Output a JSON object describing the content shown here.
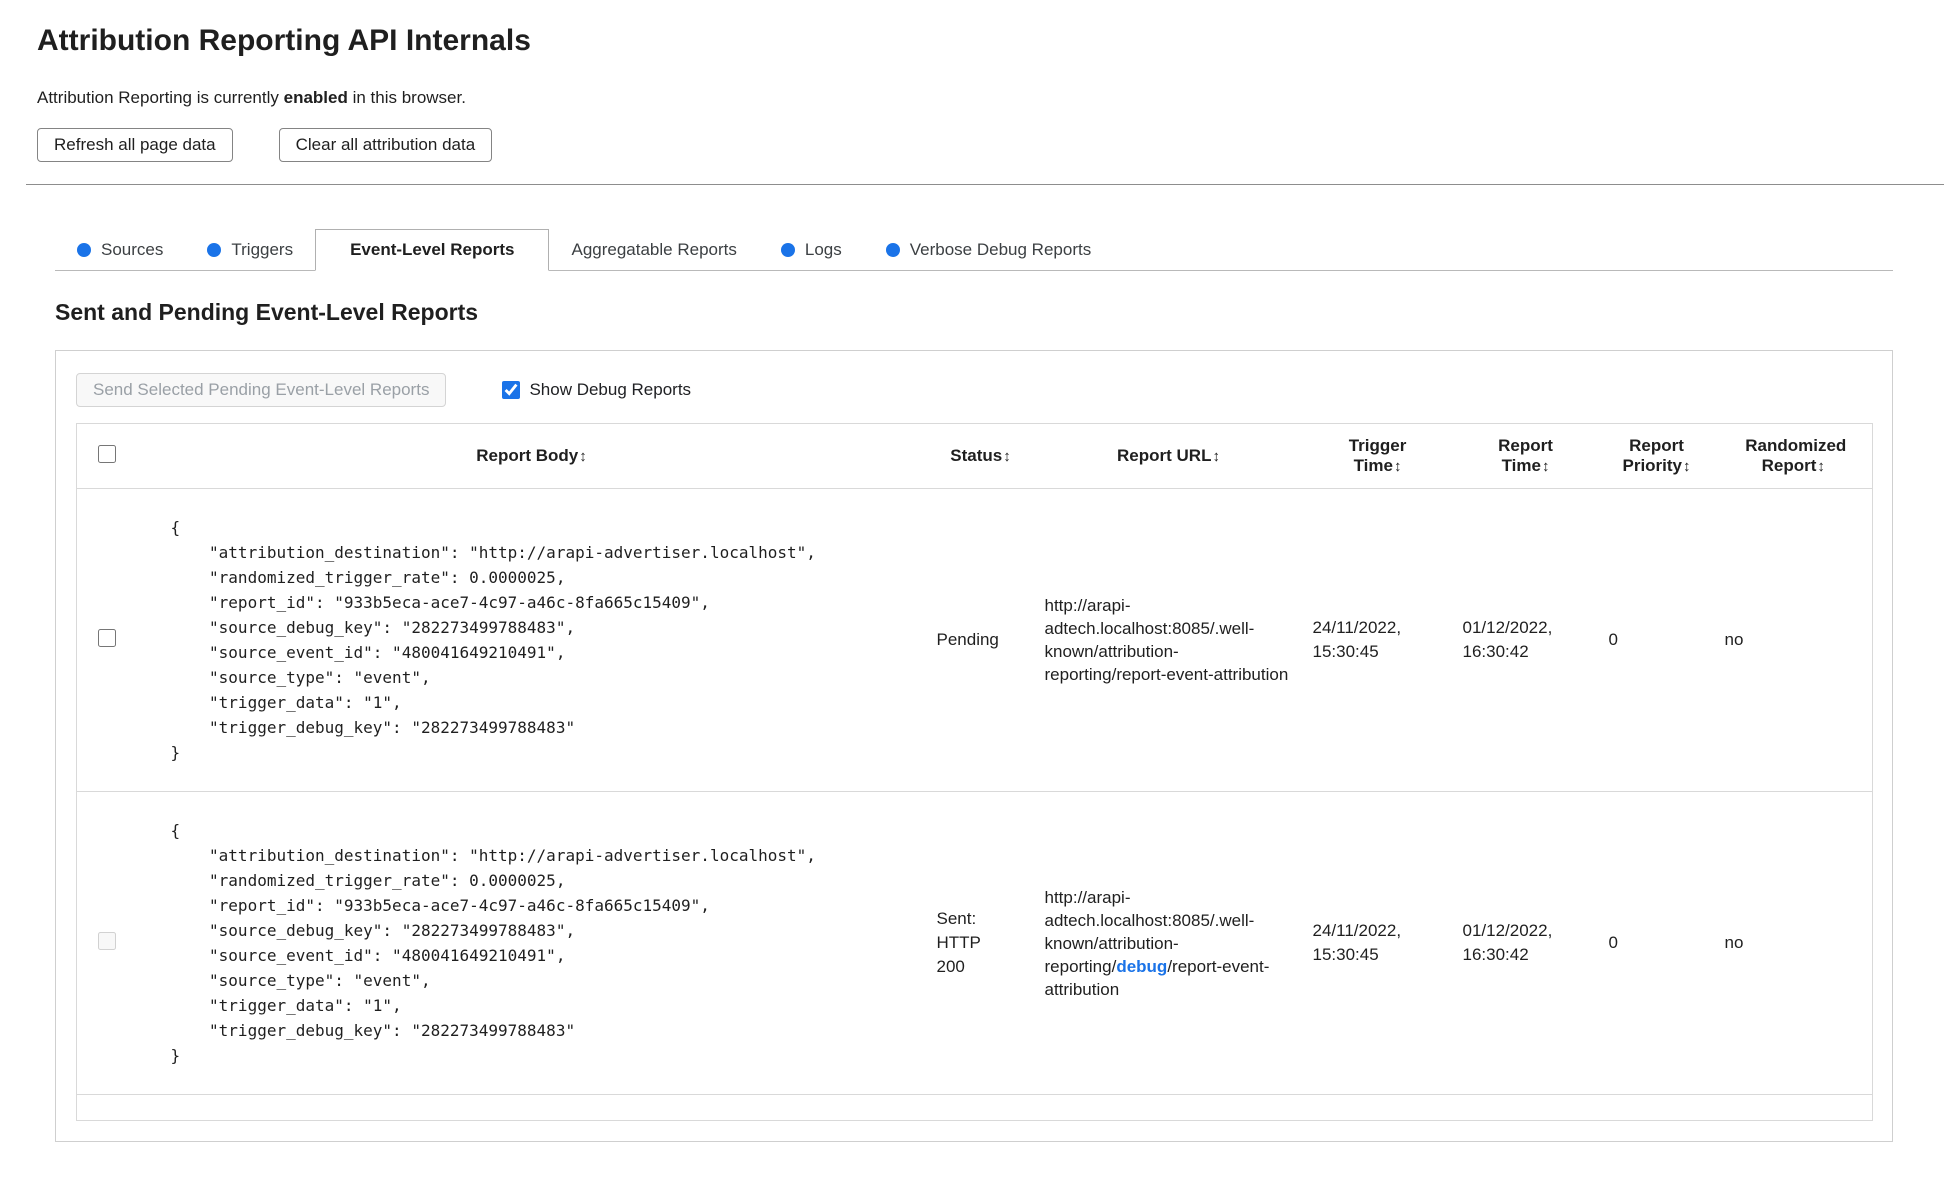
{
  "page": {
    "title": "Attribution Reporting API Internals",
    "status": {
      "prefix": "Attribution Reporting is currently ",
      "highlight": "enabled",
      "suffix": " in this browser."
    },
    "buttons": {
      "refresh": "Refresh all page data",
      "clear": "Clear all attribution data"
    }
  },
  "colors": {
    "accent_blue": "#1a73e8"
  },
  "tabs": [
    {
      "label": "Sources",
      "has_dot": true,
      "active": false
    },
    {
      "label": "Triggers",
      "has_dot": true,
      "active": false
    },
    {
      "label": "Event-Level Reports",
      "has_dot": false,
      "active": true
    },
    {
      "label": "Aggregatable Reports",
      "has_dot": false,
      "active": false
    },
    {
      "label": "Logs",
      "has_dot": true,
      "active": false
    },
    {
      "label": "Verbose Debug Reports",
      "has_dot": true,
      "active": false
    }
  ],
  "section": {
    "heading": "Sent and Pending Event-Level Reports",
    "send_button": "Send Selected Pending Event-Level Reports",
    "send_button_enabled": false,
    "show_debug_label": "Show Debug Reports",
    "show_debug_checked": true
  },
  "table": {
    "sort_icon": "↕",
    "headers": [
      "Report Body",
      "Status",
      "Report URL",
      "Trigger Time",
      "Report Time",
      "Report Priority",
      "Randomized Report"
    ],
    "rows": [
      {
        "checkbox_enabled": true,
        "checkbox_checked": false,
        "body": "{\n    \"attribution_destination\": \"http://arapi-advertiser.localhost\",\n    \"randomized_trigger_rate\": 0.0000025,\n    \"report_id\": \"933b5eca-ace7-4c97-a46c-8fa665c15409\",\n    \"source_debug_key\": \"282273499788483\",\n    \"source_event_id\": \"480041649210491\",\n    \"source_type\": \"event\",\n    \"trigger_data\": \"1\",\n    \"trigger_debug_key\": \"282273499788483\"\n}",
        "status": "Pending",
        "url_prefix": "http://arapi-adtech.localhost:8085/.well-known/attribution-reporting/report-event-attribution",
        "url_highlight": "",
        "url_suffix": "",
        "trigger_time": "24/11/2022, 15:30:45",
        "report_time": "01/12/2022, 16:30:42",
        "priority": "0",
        "randomized": "no"
      },
      {
        "checkbox_enabled": false,
        "checkbox_checked": false,
        "body": "{\n    \"attribution_destination\": \"http://arapi-advertiser.localhost\",\n    \"randomized_trigger_rate\": 0.0000025,\n    \"report_id\": \"933b5eca-ace7-4c97-a46c-8fa665c15409\",\n    \"source_debug_key\": \"282273499788483\",\n    \"source_event_id\": \"480041649210491\",\n    \"source_type\": \"event\",\n    \"trigger_data\": \"1\",\n    \"trigger_debug_key\": \"282273499788483\"\n}",
        "status": "Sent: HTTP 200",
        "url_prefix": "http://arapi-adtech.localhost:8085/.well-known/attribution-reporting/",
        "url_highlight": "debug",
        "url_suffix": "/report-event-attribution",
        "trigger_time": "24/11/2022, 15:30:45",
        "report_time": "01/12/2022, 16:30:42",
        "priority": "0",
        "randomized": "no"
      }
    ]
  }
}
